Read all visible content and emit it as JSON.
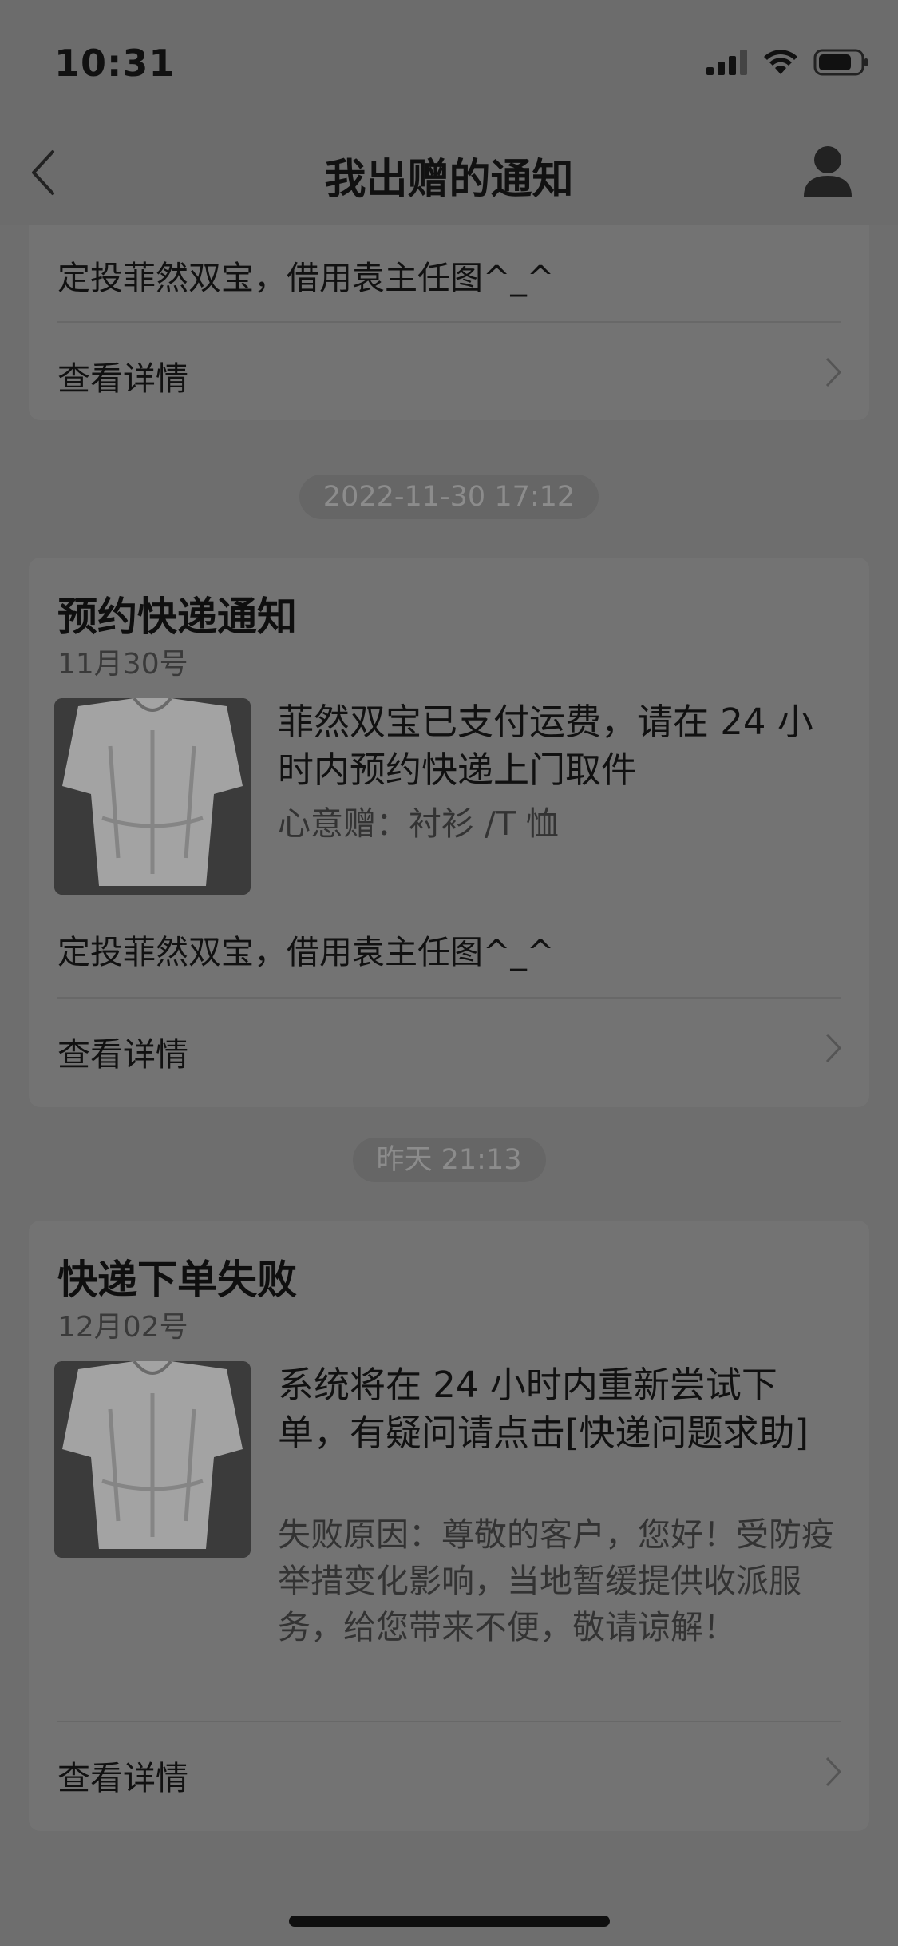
{
  "status_bar": {
    "time": "10:31",
    "icons": [
      "signal-icon",
      "wifi-icon",
      "battery-icon"
    ]
  },
  "nav": {
    "title": "我出赠的通知",
    "back_icon": "chevron-left-icon",
    "profile_icon": "person-icon"
  },
  "cards": [
    {
      "note": "定投菲然双宝，借用袁主任图^_^",
      "detail_label": "查看详情"
    },
    {
      "timestamp": "2022-11-30 17:12",
      "title": "预约快递通知",
      "date": "11月30号",
      "message": "菲然双宝已支付运费，请在 24 小时内预约快递上门取件",
      "sub": "心意赠：衬衫 /T 恤",
      "note": "定投菲然双宝，借用袁主任图^_^",
      "detail_label": "查看详情"
    },
    {
      "timestamp": "昨天 21:13",
      "title": "快递下单失败",
      "date": "12月02号",
      "message": "系统将在 24 小时内重新尝试下单，有疑问请点击[快递问题求助]",
      "sub": "失败原因：尊敬的客户，您好！受防疫举措变化影响，当地暂缓提供收派服务，给您带来不便，敬请谅解！",
      "detail_label": "查看详情"
    }
  ],
  "colors": {
    "overlay_bg": "#6e6e6e",
    "card_bg": "#737373",
    "text_primary": "#111111",
    "text_secondary": "#333333"
  }
}
